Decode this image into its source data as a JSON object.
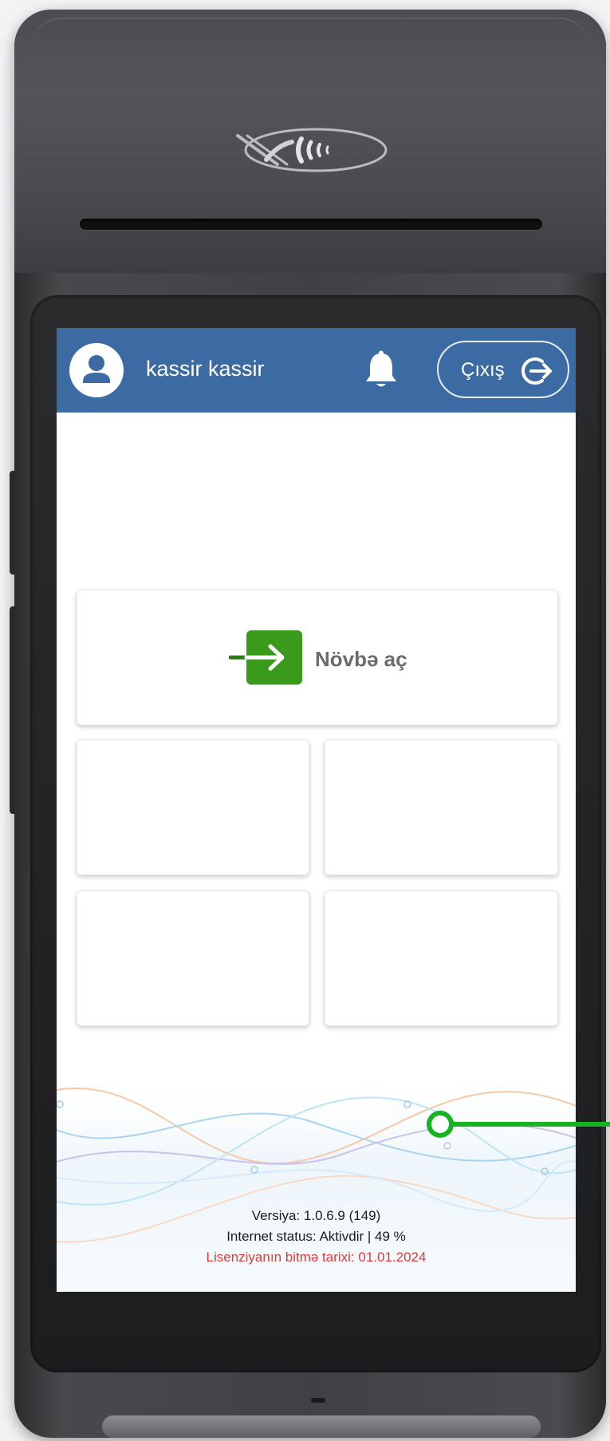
{
  "header": {
    "user_name": "kassir kassir",
    "logout_label": "Çıxış"
  },
  "main": {
    "open_shift_label": "Növbə aç"
  },
  "footer": {
    "version": "Versiya: 1.0.6.9 (149)",
    "internet_status": "Internet status: Aktivdir | 49 %",
    "license_expiry": "Lisenziyanın bitmə tarixi: 01.01.2024"
  },
  "colors": {
    "header_bg": "#3c6ba3",
    "shift_icon_green": "#3a9a1c",
    "license_text_red": "#e23a3a",
    "callout_green": "#18b322"
  },
  "icons": {
    "avatar": "user-icon",
    "notifications": "bell-icon",
    "logout": "logout-icon",
    "open_shift": "enter-arrow-icon",
    "device_contactless": "nfc-icon"
  }
}
